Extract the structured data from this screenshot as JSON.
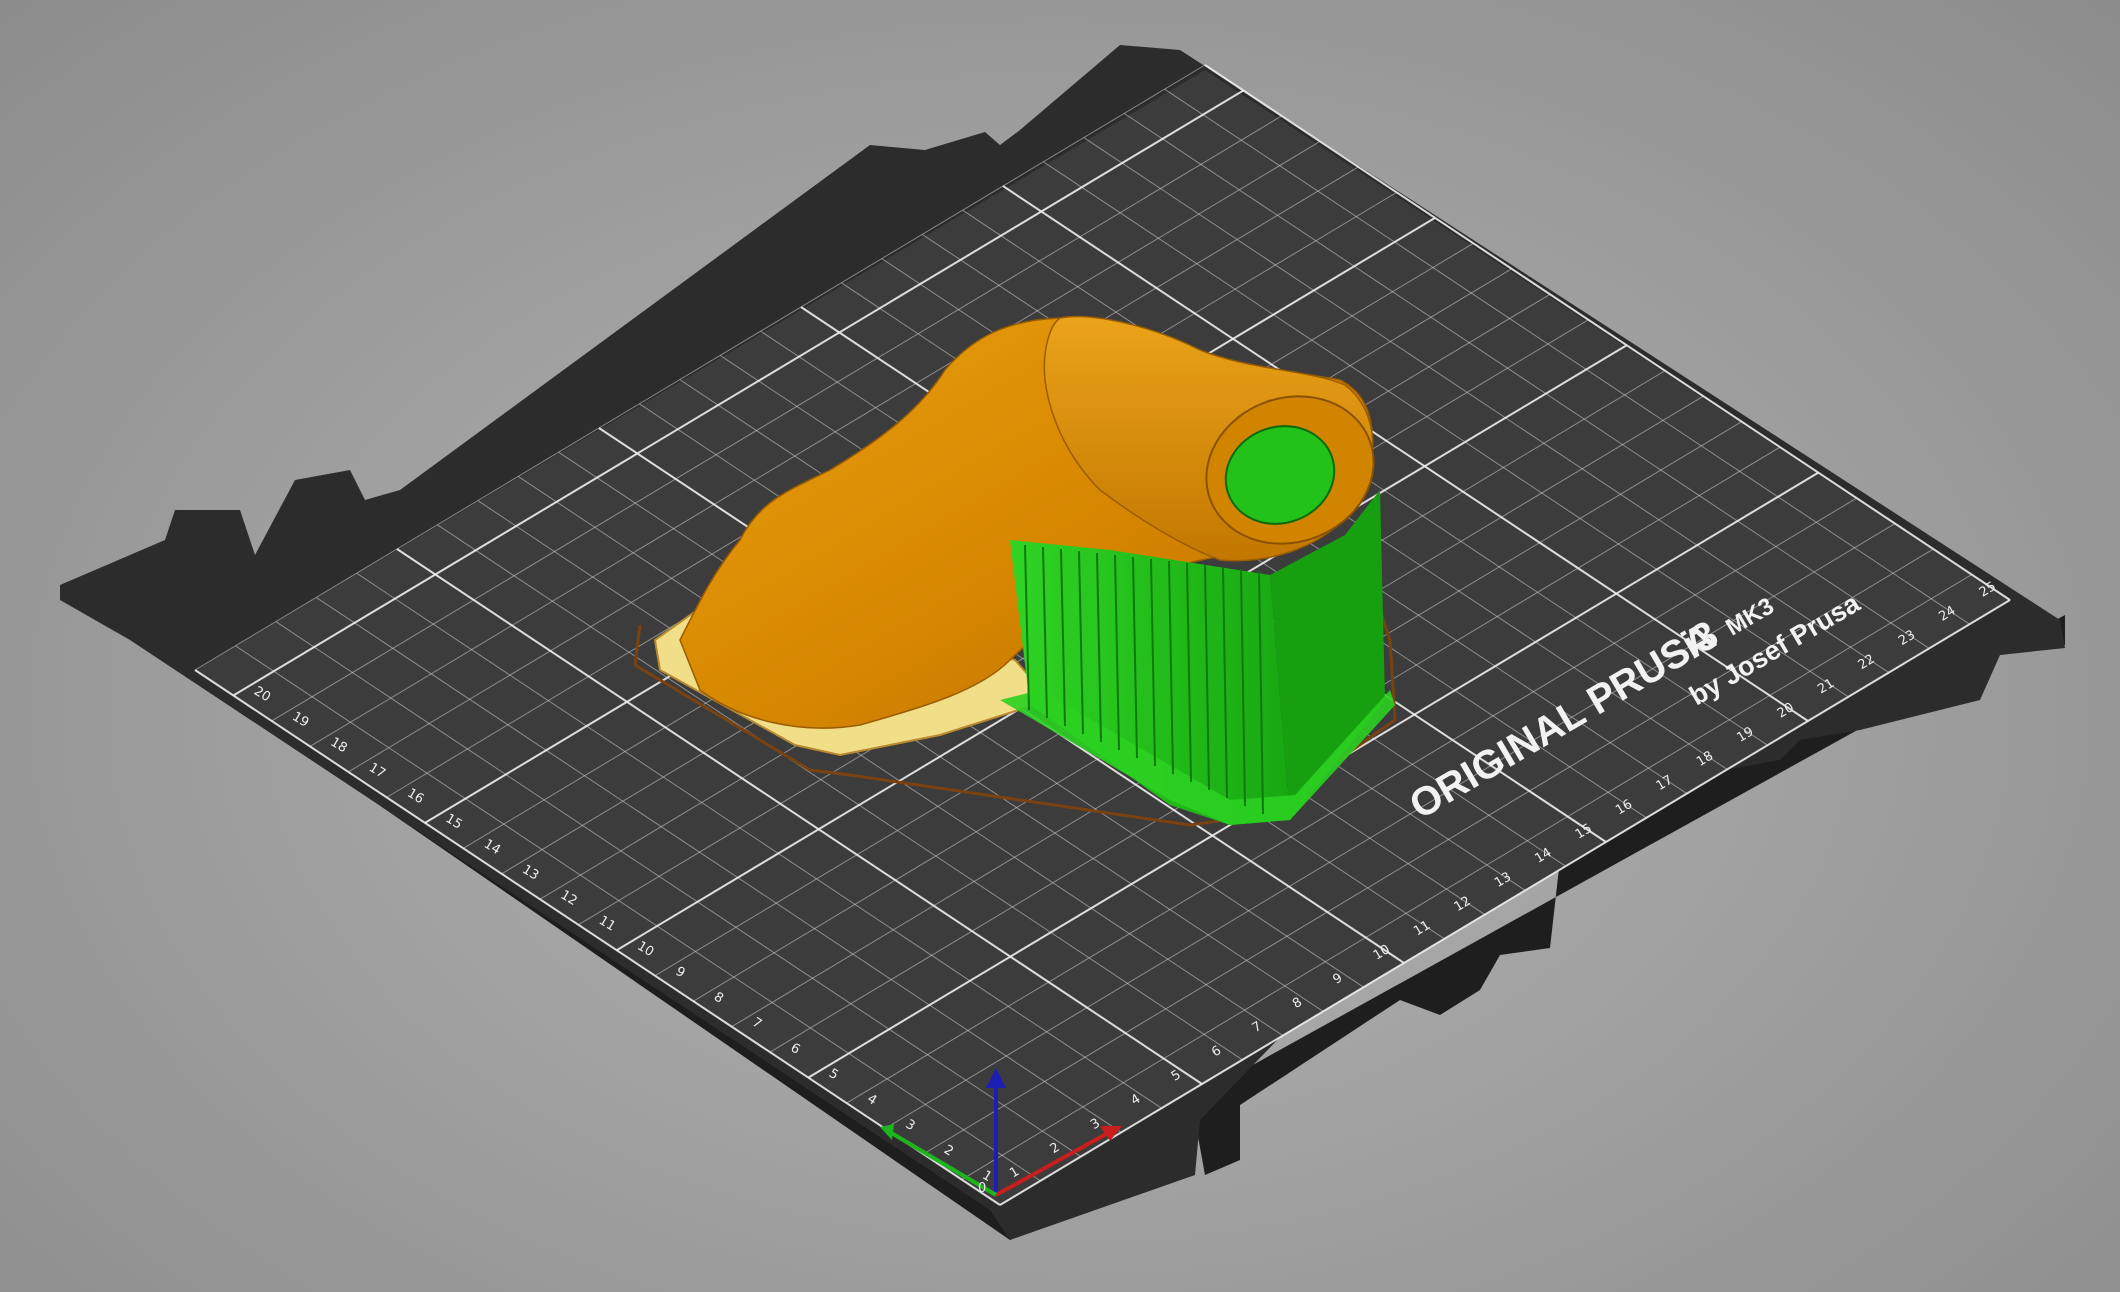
{
  "app": {
    "window_title": "",
    "view": "3D preview"
  },
  "bed": {
    "brand_line1": "ORIGINAL PRUSA",
    "brand_model": "i3",
    "brand_version": "MK3",
    "brand_line2": "by Josef Prusa",
    "x_ticks": [
      "1",
      "2",
      "3",
      "4",
      "5",
      "6",
      "7",
      "8",
      "9",
      "10",
      "11",
      "12",
      "13",
      "14",
      "15",
      "16",
      "17",
      "18",
      "19",
      "20",
      "21",
      "22",
      "23",
      "24",
      "25"
    ],
    "y_ticks": [
      "1",
      "2",
      "3",
      "4",
      "5",
      "6",
      "7",
      "8",
      "9",
      "10",
      "11",
      "12",
      "13",
      "14",
      "15",
      "16",
      "17",
      "18",
      "19",
      "20"
    ]
  },
  "axes": {
    "origin_label": "0",
    "x_color": "#c81e1e",
    "y_color": "#1eb41e",
    "z_color": "#1e1eb4"
  },
  "colors": {
    "bed_frame": "#2e2e2e",
    "bed_surface": "#3b3b3b",
    "grid_line": "#d8d8d8",
    "model_perimeter": "#d98a00",
    "model_first_layer": "#f2e38c",
    "support": "#22c41a",
    "skirt": "#8a4a10"
  }
}
